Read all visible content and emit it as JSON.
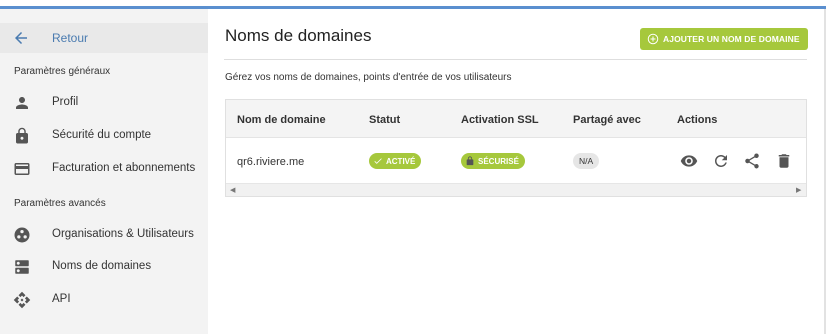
{
  "sidebar": {
    "back_label": "Retour",
    "section_general": "Paramètres généraux",
    "section_advanced": "Paramètres avancés",
    "items": [
      {
        "label": "Profil",
        "icon": "person-icon"
      },
      {
        "label": "Sécurité du compte",
        "icon": "lock-icon"
      },
      {
        "label": "Facturation et abonnements",
        "icon": "credit-card-icon"
      },
      {
        "label": "Organisations & Utilisateurs",
        "icon": "organization-icon"
      },
      {
        "label": "Noms de domaines",
        "icon": "dns-icon"
      },
      {
        "label": "API",
        "icon": "api-icon"
      }
    ]
  },
  "main": {
    "title": "Noms de domaines",
    "add_button_label": "AJOUTER UN NOM DE DOMAINE",
    "description": "Gérez vos noms de domaines, points d'entrée de vos utilisateurs",
    "table": {
      "headers": [
        "Nom de domaine",
        "Statut",
        "Activation SSL",
        "Partagé avec",
        "Actions"
      ],
      "rows": [
        {
          "domain": "qr6.riviere.me",
          "status": "ACTIVÉ",
          "ssl": "SÉCURISÉ",
          "shared": "N/A"
        }
      ]
    }
  },
  "colors": {
    "accent_green": "#a6c83c",
    "link_blue": "#4a7bb0",
    "top_bar": "#5a8fcf"
  }
}
